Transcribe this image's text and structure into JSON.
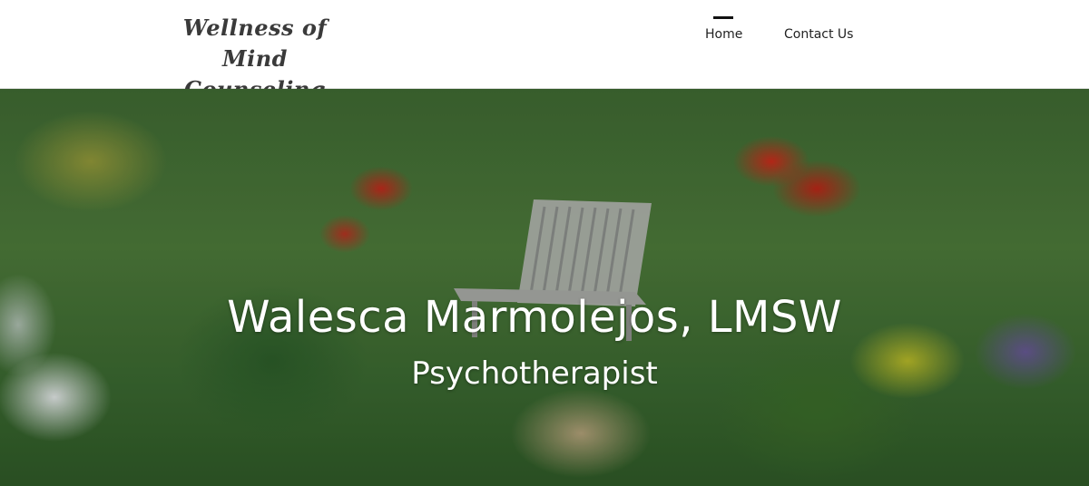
{
  "header": {
    "logo_line1": "Wellness of Mind",
    "logo_line2": "Counseling"
  },
  "nav": {
    "items": [
      {
        "label": "Home",
        "active": true
      },
      {
        "label": "Contact Us",
        "active": false
      }
    ]
  },
  "hero": {
    "title": "Walesca Marmolejos, LMSW",
    "subtitle": "Psychotherapist",
    "background_image": "garden-with-bench"
  },
  "colors": {
    "header_bg": "#ffffff",
    "text_dark": "#222222",
    "hero_text": "#ffffff",
    "active_indicator": "#111111"
  }
}
